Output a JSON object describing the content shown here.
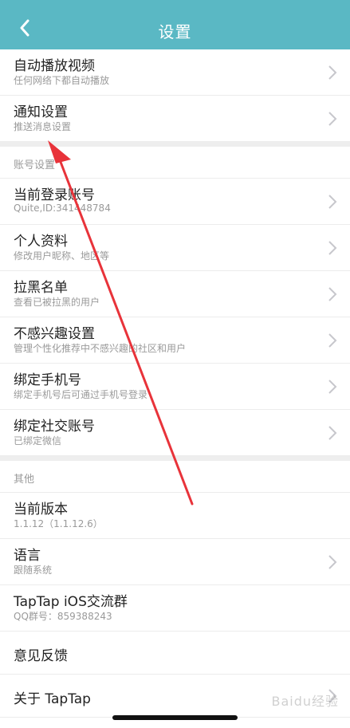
{
  "header": {
    "title": "设置"
  },
  "rows_top": [
    {
      "title": "自动播放视频",
      "subtitle": "任何网络下都自动播放"
    },
    {
      "title": "通知设置",
      "subtitle": "推送消息设置"
    }
  ],
  "account_section": {
    "label": "账号设置",
    "rows": [
      {
        "title": "当前登录账号",
        "subtitle": "Quite,ID:341448784"
      },
      {
        "title": "个人资料",
        "subtitle": "修改用户昵称、地区等"
      },
      {
        "title": "拉黑名单",
        "subtitle": "查看已被拉黑的用户"
      },
      {
        "title": "不感兴趣设置",
        "subtitle": "管理个性化推荐中不感兴趣的社区和用户"
      },
      {
        "title": "绑定手机号",
        "subtitle": "绑定手机号后可通过手机号登录"
      },
      {
        "title": "绑定社交账号",
        "subtitle": "已绑定微信"
      }
    ]
  },
  "other_section": {
    "label": "其他",
    "rows": [
      {
        "title": "当前版本",
        "subtitle": "1.1.12（1.1.12.6）"
      },
      {
        "title": "语言",
        "subtitle": "跟随系统"
      },
      {
        "title": "TapTap iOS交流群",
        "subtitle": "QQ群号：859388243"
      },
      {
        "title": "意见反馈"
      },
      {
        "title": "关于 TapTap"
      }
    ]
  },
  "watermark": "Baidu经验",
  "colors": {
    "header": "#5ab8c4",
    "arrow": "#e8333a"
  }
}
